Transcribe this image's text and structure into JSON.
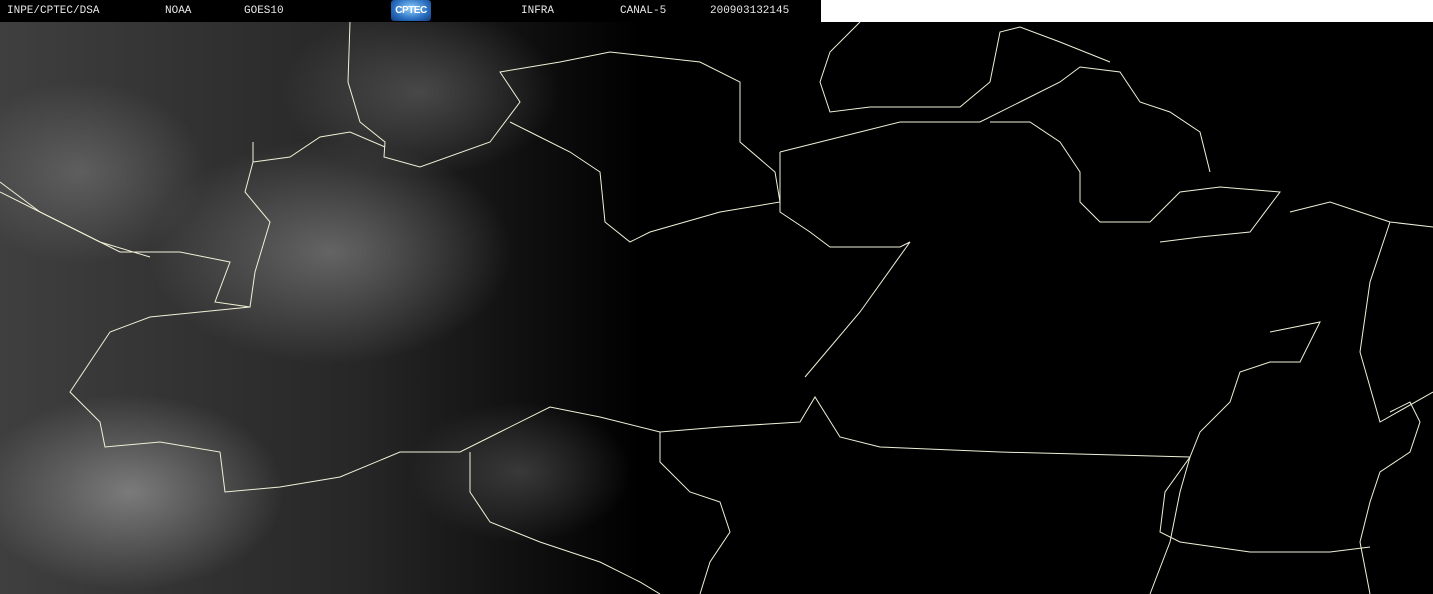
{
  "header": {
    "source": "INPE/CPTEC/DSA",
    "agency": "NOAA",
    "satellite": "GOES10",
    "logo_text": "CPTEC",
    "product": "INFRA",
    "channel": "CANAL-5",
    "timestamp": "200903132145"
  }
}
